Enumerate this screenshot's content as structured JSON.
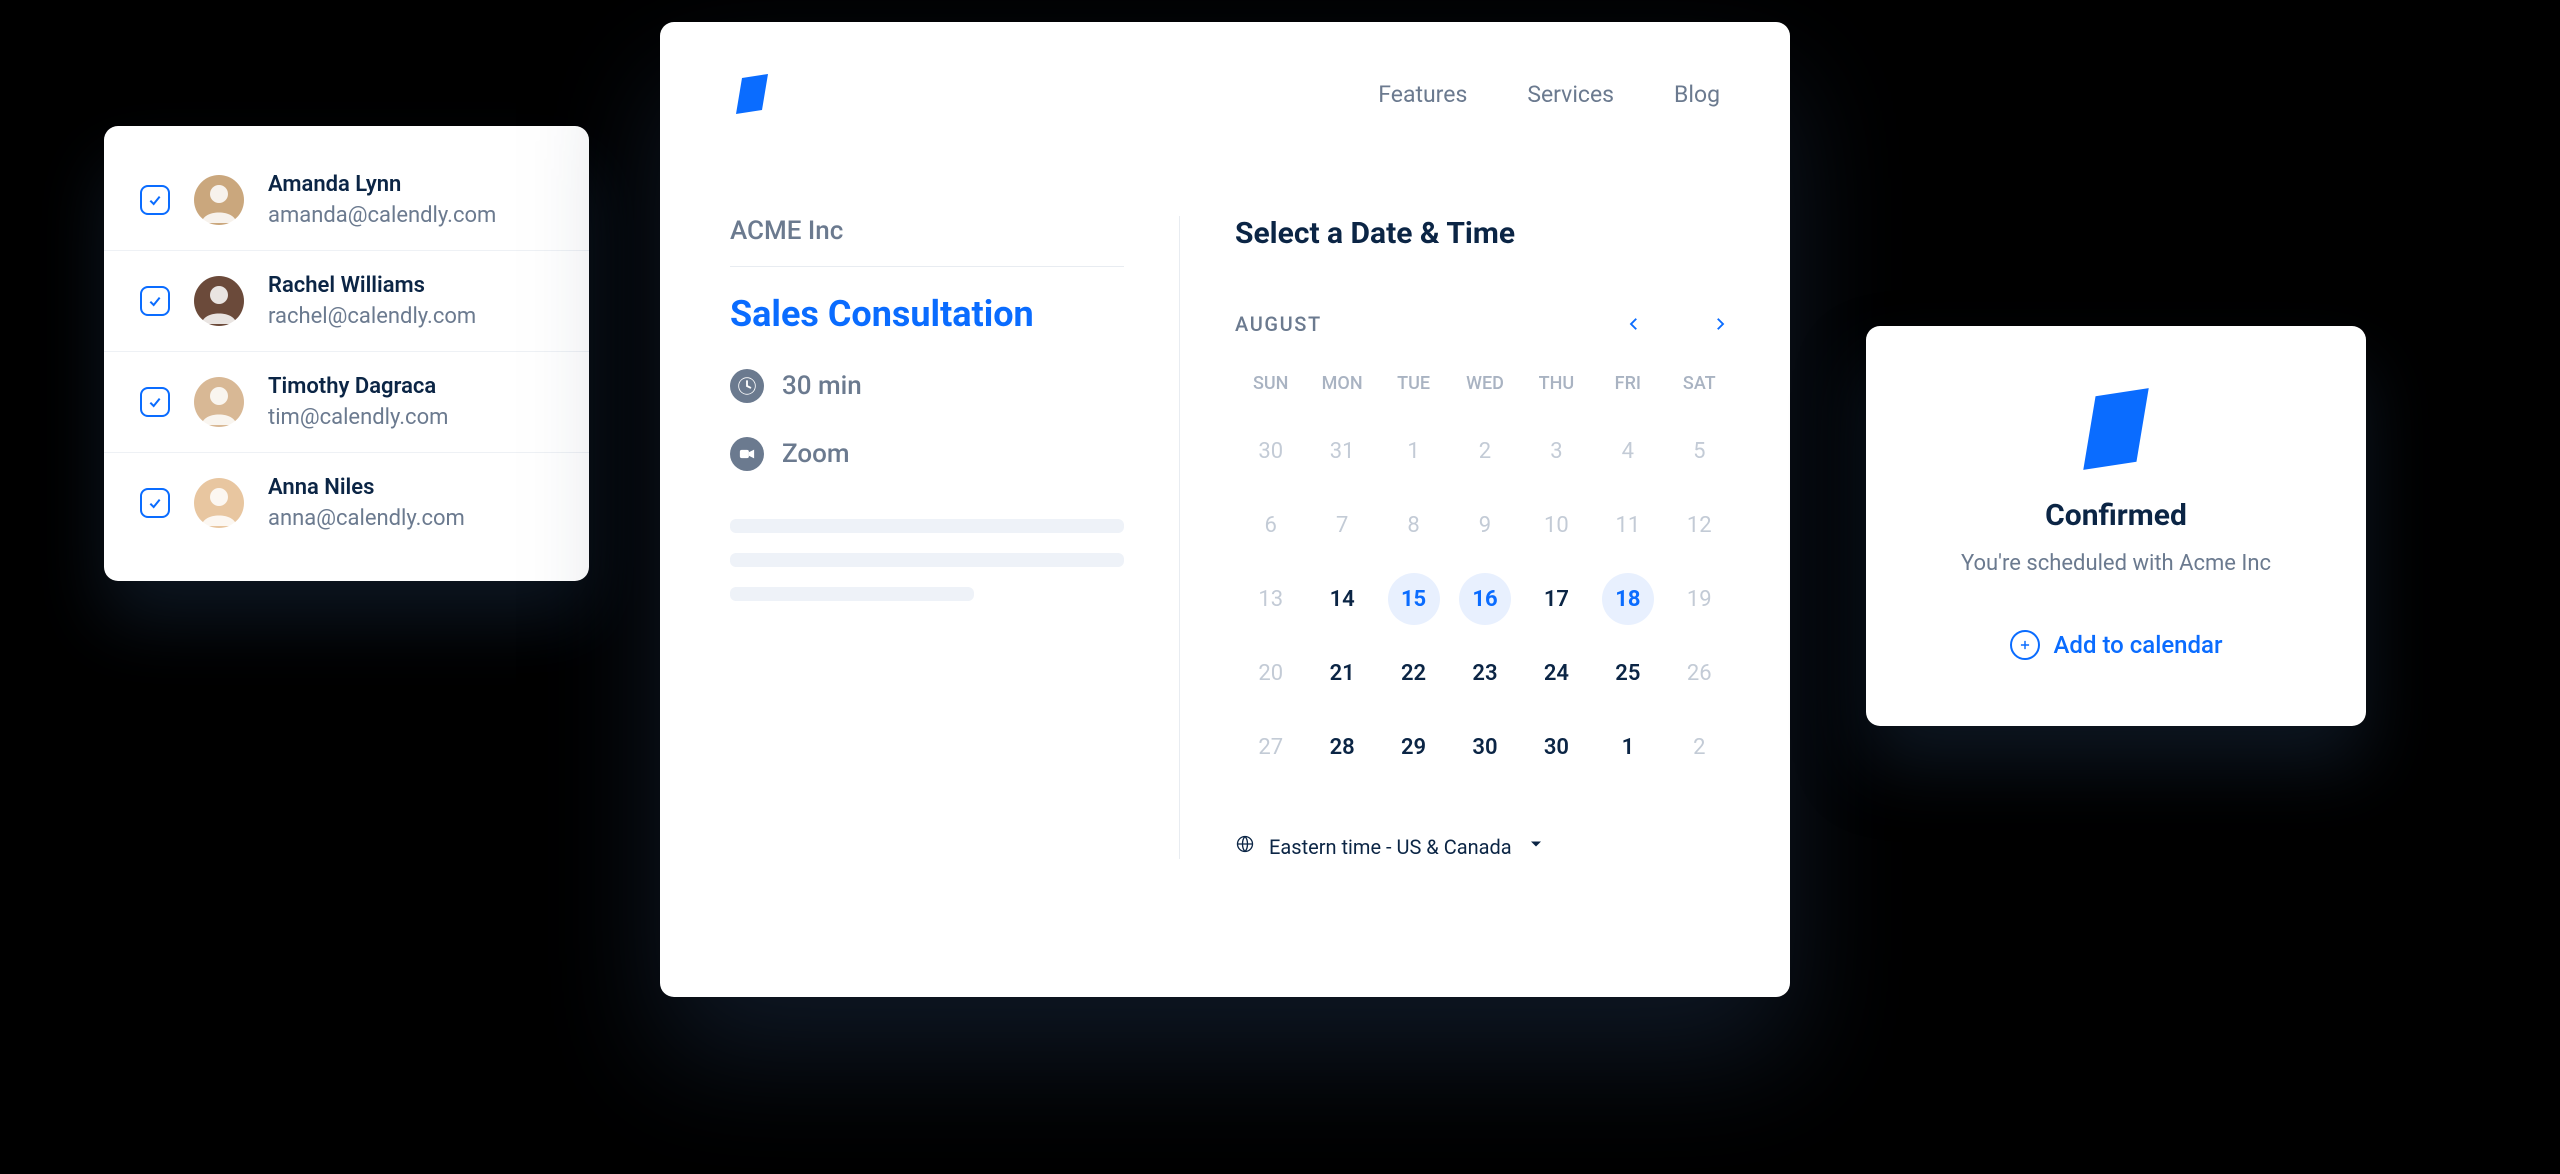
{
  "users": [
    {
      "name": "Amanda Lynn",
      "email": "amanda@calendly.com",
      "color": "#caa77d"
    },
    {
      "name": "Rachel Williams",
      "email": "rachel@calendly.com",
      "color": "#6b4a3a"
    },
    {
      "name": "Timothy Dagraca",
      "email": "tim@calendly.com",
      "color": "#d8b895"
    },
    {
      "name": "Anna Niles",
      "email": "anna@calendly.com",
      "color": "#e8c6a0"
    }
  ],
  "nav": {
    "features": "Features",
    "services": "Services",
    "blog": "Blog"
  },
  "event": {
    "company": "ACME Inc",
    "title": "Sales Consultation",
    "duration": "30 min",
    "platform": "Zoom"
  },
  "calendar": {
    "select_title": "Select a Date & Time",
    "month": "AUGUST",
    "dow": [
      "SUN",
      "MON",
      "TUE",
      "WED",
      "THU",
      "FRI",
      "SAT"
    ],
    "weeks": [
      [
        {
          "n": "30",
          "s": "muted"
        },
        {
          "n": "31",
          "s": "muted"
        },
        {
          "n": "1",
          "s": "muted"
        },
        {
          "n": "2",
          "s": "muted"
        },
        {
          "n": "3",
          "s": "muted"
        },
        {
          "n": "4",
          "s": "muted"
        },
        {
          "n": "5",
          "s": "muted"
        }
      ],
      [
        {
          "n": "6",
          "s": "muted"
        },
        {
          "n": "7",
          "s": "muted"
        },
        {
          "n": "8",
          "s": "muted"
        },
        {
          "n": "9",
          "s": "muted"
        },
        {
          "n": "10",
          "s": "muted"
        },
        {
          "n": "11",
          "s": "muted"
        },
        {
          "n": "12",
          "s": "muted"
        }
      ],
      [
        {
          "n": "13",
          "s": "muted"
        },
        {
          "n": "14",
          "s": "normal"
        },
        {
          "n": "15",
          "s": "highlight"
        },
        {
          "n": "16",
          "s": "highlight"
        },
        {
          "n": "17",
          "s": "normal"
        },
        {
          "n": "18",
          "s": "highlight"
        },
        {
          "n": "19",
          "s": "muted"
        }
      ],
      [
        {
          "n": "20",
          "s": "muted"
        },
        {
          "n": "21",
          "s": "normal"
        },
        {
          "n": "22",
          "s": "normal"
        },
        {
          "n": "23",
          "s": "normal"
        },
        {
          "n": "24",
          "s": "normal"
        },
        {
          "n": "25",
          "s": "normal"
        },
        {
          "n": "26",
          "s": "muted"
        }
      ],
      [
        {
          "n": "27",
          "s": "muted"
        },
        {
          "n": "28",
          "s": "normal"
        },
        {
          "n": "29",
          "s": "normal"
        },
        {
          "n": "30",
          "s": "normal"
        },
        {
          "n": "30",
          "s": "normal"
        },
        {
          "n": "1",
          "s": "normal"
        },
        {
          "n": "2",
          "s": "muted"
        }
      ]
    ],
    "timezone": "Eastern time - US & Canada"
  },
  "confirmation": {
    "title": "Confirmed",
    "subtitle": "You're scheduled with Acme Inc",
    "add_label": "Add to calendar"
  }
}
